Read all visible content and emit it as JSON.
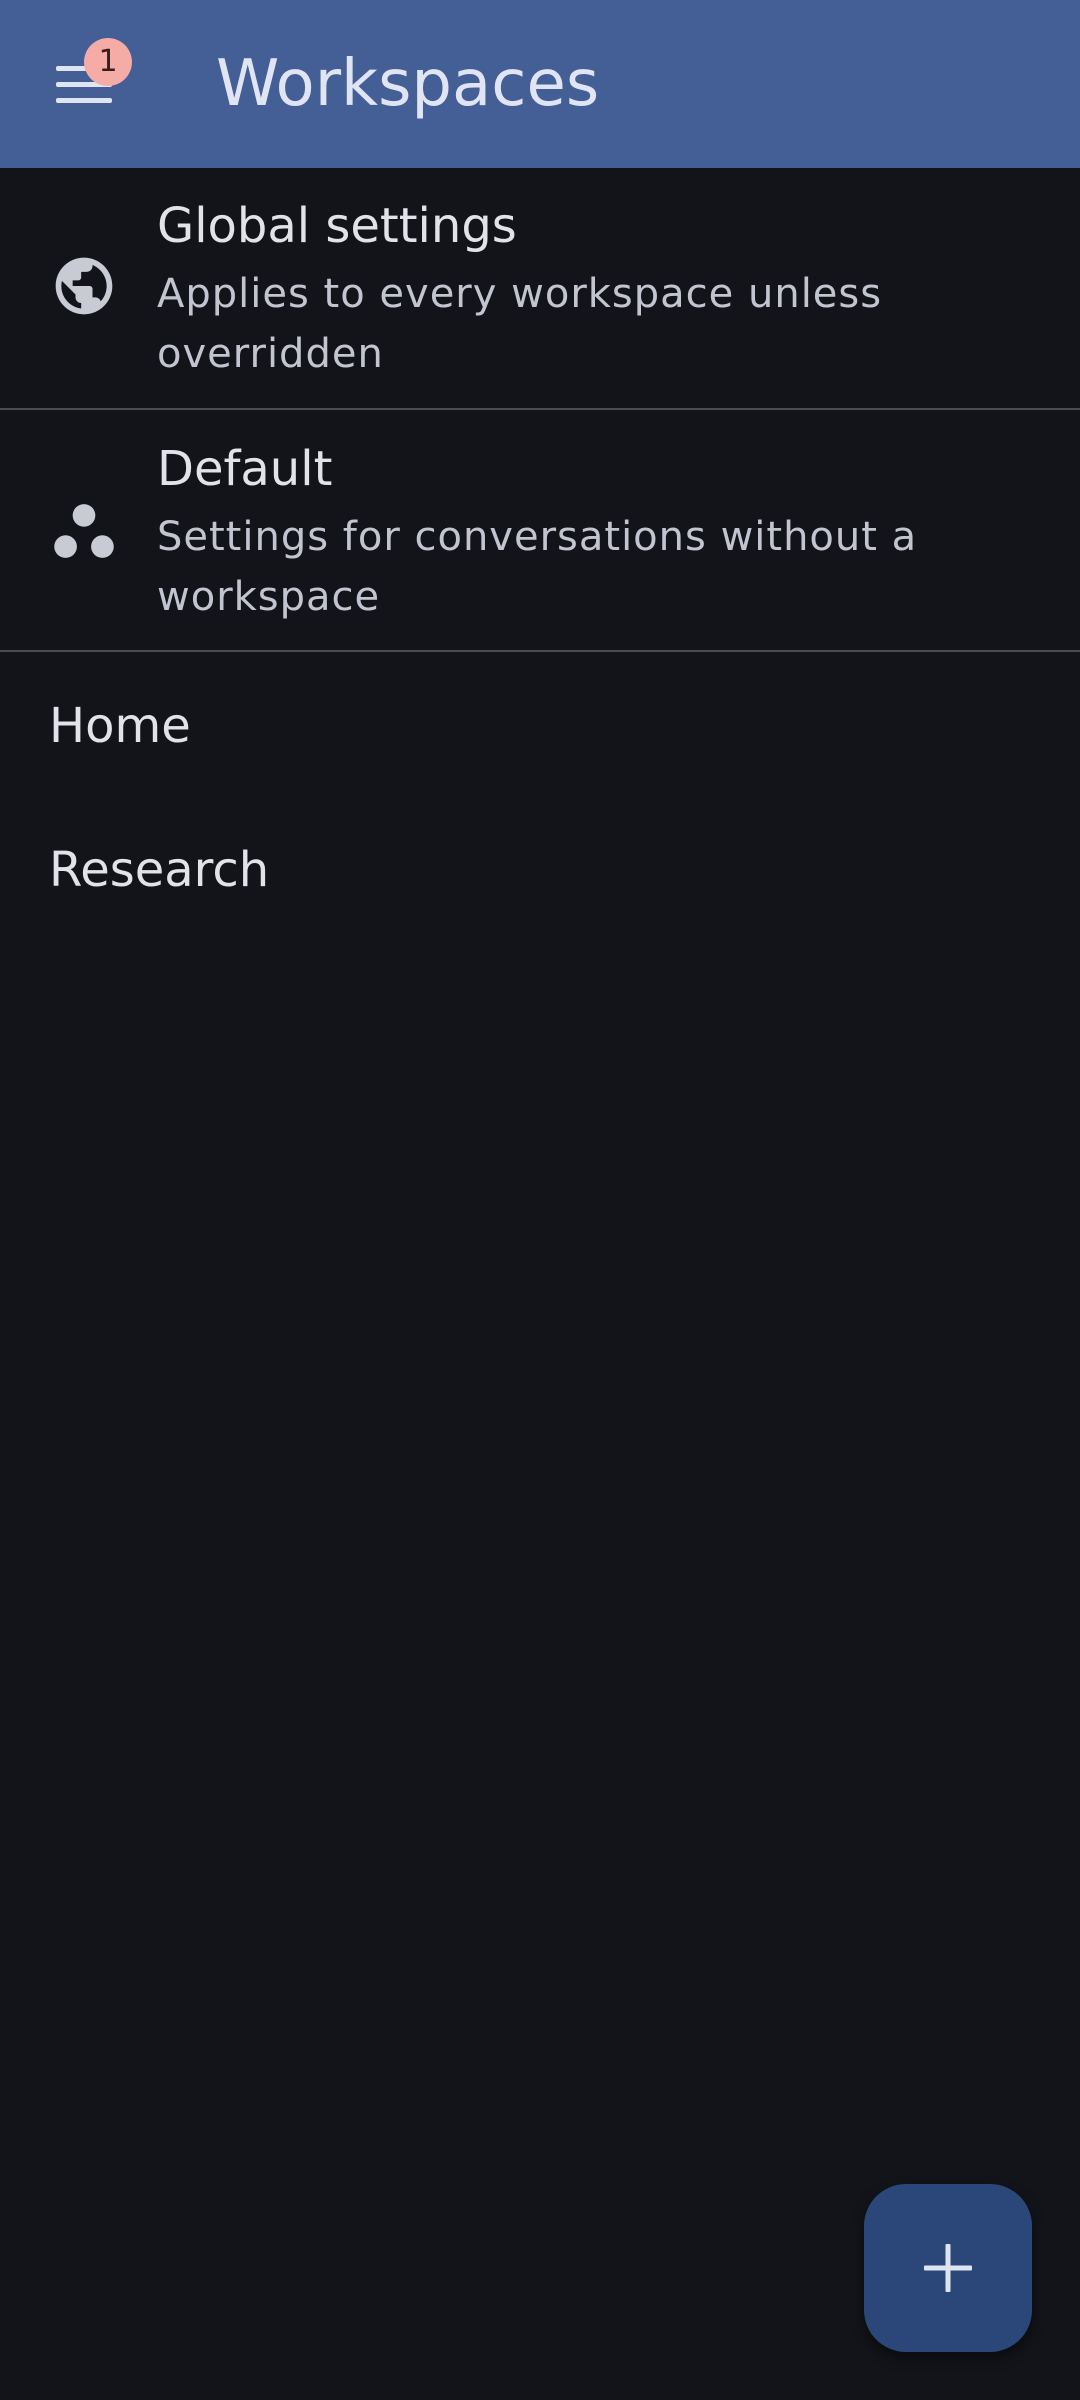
{
  "app_bar": {
    "title": "Workspaces",
    "menu_icon": "menu-icon",
    "notification_badge": "1",
    "background_color": "#435f96",
    "badge_color": "#f5aba6"
  },
  "special_items": [
    {
      "title": "Global settings",
      "subtitle": "Applies to every workspace unless overridden",
      "icon": "globe-icon"
    },
    {
      "title": "Default",
      "subtitle": "Settings for conversations without a workspace",
      "icon": "workspaces-icon"
    }
  ],
  "workspaces": [
    {
      "label": "Home"
    },
    {
      "label": "Research"
    }
  ],
  "fab": {
    "icon": "add-icon",
    "color": "#2b4779"
  },
  "theme": {
    "background": "#131419",
    "divider": "#4a4c52"
  }
}
